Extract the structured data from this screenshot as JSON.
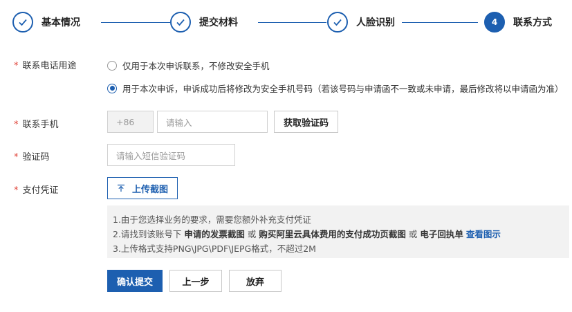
{
  "steps": [
    {
      "label": "基本情况",
      "status": "done"
    },
    {
      "label": "提交材料",
      "status": "done"
    },
    {
      "label": "人脸识别",
      "status": "done"
    },
    {
      "label": "联系方式",
      "number": "4",
      "status": "active"
    }
  ],
  "form": {
    "required_mark": "*",
    "usage_label": "联系电话用途",
    "usage_options": [
      {
        "label": "仅用于本次申诉联系，不修改安全手机",
        "checked": false
      },
      {
        "label": "用于本次申诉，申诉成功后将修改为安全手机号码（若该号码与申请函不一致或未申请，最后修改将以申请函为准）",
        "checked": true
      }
    ],
    "phone_label": "联系手机",
    "phone_prefix": "+86",
    "phone_placeholder": "请输入",
    "get_code_button": "获取验证码",
    "code_label": "验证码",
    "code_placeholder": "请输入短信验证码",
    "proof_label": "支付凭证",
    "upload_button": "上传截图"
  },
  "notice": {
    "line1": "1.由于您选择业务的要求，需要您额外补充支付凭证",
    "line2_parts": {
      "p1": "2.请找到该账号下 ",
      "b1": "申请的发票截图",
      "p2": " 或 ",
      "b2": "购买阿里云具体费用的支付成功页截图",
      "p3": " 或 ",
      "b3": "电子回执单",
      "p4": " ",
      "link": "查看图示"
    },
    "line3": "3.上传格式支持PNG\\JPG\\PDF\\JEPG格式，不超过2M"
  },
  "actions": {
    "submit": "确认提交",
    "prev": "上一步",
    "abandon": "放弃"
  },
  "colors": {
    "primary": "#1d5fb0",
    "required": "#e0463c"
  }
}
